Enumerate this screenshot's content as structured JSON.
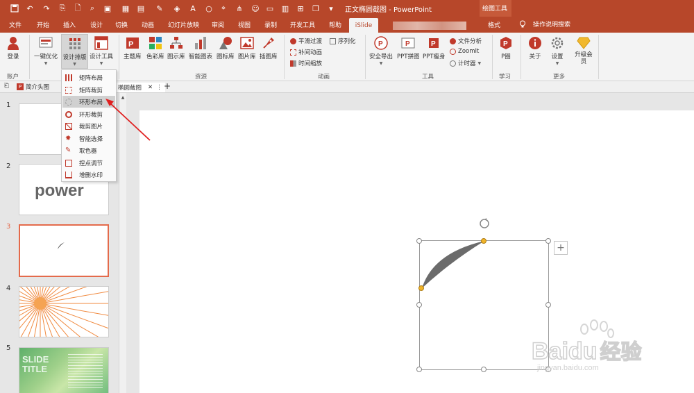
{
  "window": {
    "title": "正文椭圆截图 - PowerPoint",
    "context_tab": "绘图工具",
    "colors": {
      "accent": "#b7472a",
      "ribbon_bg": "#f3f3f3",
      "selection_border": "#e46a4b",
      "shape_fill": "#6b6b6b"
    }
  },
  "tabs": [
    "文件",
    "开始",
    "插入",
    "设计",
    "切换",
    "动画",
    "幻灯片放映",
    "审阅",
    "视图",
    "录制",
    "开发工具",
    "帮助",
    "iSlide",
    "格式"
  ],
  "active_tab": "iSlide",
  "tell_me": "操作说明搜索",
  "ribbon": {
    "account": {
      "label": "登录",
      "group": "账户"
    },
    "design": {
      "one_click": "一键优化",
      "layout": "设计排版",
      "tools": "设计工具"
    },
    "resources": {
      "group": "资源",
      "items": [
        "主题库",
        "色彩库",
        "图示库",
        "智能图表",
        "图标库",
        "图片库",
        "插图库"
      ]
    },
    "animation": {
      "group": "动画",
      "smooth": "平滑过渡",
      "sequence": "序列化",
      "tween": "补间动画",
      "time_zoom": "时间缩放"
    },
    "tools": {
      "group": "工具",
      "safe_export": "安全导出",
      "ppt_grid": "PPT拼图",
      "ppt_slim": "PPT瘦身",
      "file_analysis": "文件分析",
      "zoomit": "ZoomIt",
      "timer": "计时器"
    },
    "learn": {
      "label": "P圈",
      "group": "学习"
    },
    "more": {
      "group": "更多",
      "about": "关于",
      "settings": "设置",
      "upgrade": "升级会员"
    }
  },
  "doc_tabs": [
    {
      "label": "简介头图"
    },
    {
      "label": "椭圆截图",
      "active": true
    }
  ],
  "dropdown": {
    "items": [
      "矩阵布局",
      "矩阵裁剪",
      "环形布局",
      "环形裁剪",
      "裁剪图片",
      "智能选择",
      "取色器",
      "控点调节",
      "增删水印"
    ],
    "highlighted": "环形布局"
  },
  "slides": [
    {
      "num": "1"
    },
    {
      "num": "2",
      "text": "power"
    },
    {
      "num": "3",
      "selected": true
    },
    {
      "num": "4"
    },
    {
      "num": "5",
      "text": "SLIDE TITLE"
    }
  ],
  "watermark": {
    "brand": "Bai",
    "mid": "du",
    "suffix": "经验",
    "url": "jingyan.baidu.com"
  }
}
